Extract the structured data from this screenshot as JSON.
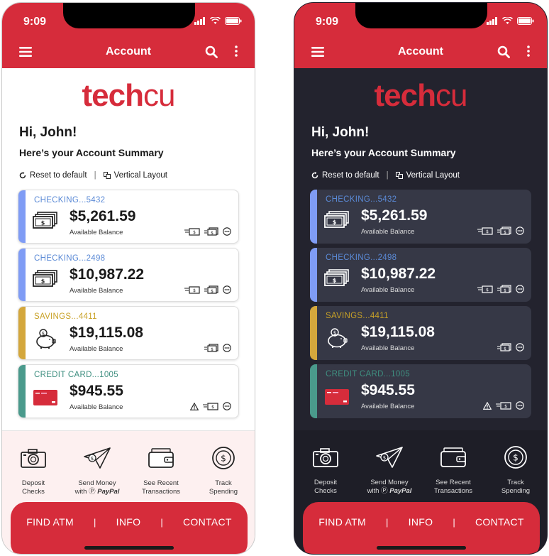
{
  "status_bar": {
    "time": "9:09"
  },
  "header": {
    "title": "Account"
  },
  "brand": {
    "logo_tech": "tech",
    "logo_cu": "cu"
  },
  "greeting": {
    "hello": "Hi, John!",
    "summary": "Here’s your Account Summary"
  },
  "layout_options": {
    "reset": "Reset to default",
    "separator": "|",
    "vertical": "Vertical Layout"
  },
  "accounts": [
    {
      "name": "CHECKING...5432",
      "amount": "$5,261.59",
      "label": "Available Balance",
      "stripe_color": "#7f9cf5",
      "name_color": "#5b8ad6",
      "type": "cash"
    },
    {
      "name": "CHECKING...2498",
      "amount": "$10,987.22",
      "label": "Available Balance",
      "stripe_color": "#7f9cf5",
      "name_color": "#5b8ad6",
      "type": "cash"
    },
    {
      "name": "SAVINGS...4411",
      "amount": "$19,115.08",
      "label": "Available Balance",
      "stripe_color": "#d4a73c",
      "name_color": "#c9a227",
      "type": "piggy"
    },
    {
      "name": "CREDIT CARD...1005",
      "amount": "$945.55",
      "label": "Available Balance",
      "stripe_color": "#4a9a8c",
      "name_color": "#3f8f80",
      "type": "card"
    }
  ],
  "quick_actions": [
    {
      "line1": "Deposit",
      "line2": "Checks",
      "icon": "camera-icon"
    },
    {
      "line1": "Send Money",
      "line2": "with",
      "line2_brand": "PayPal",
      "icon": "paper-plane-icon"
    },
    {
      "line1": "See Recent",
      "line2": "Transactions",
      "icon": "wallet-icon"
    },
    {
      "line1": "Track",
      "line2": "Spending",
      "icon": "coin-icon"
    }
  ],
  "bottom_nav": {
    "find_atm": "FIND ATM",
    "info": "INFO",
    "contact": "CONTACT",
    "separator": "|"
  },
  "colors": {
    "brand_red": "#d62c3b",
    "dark_bg": "#23232e",
    "dark_card": "#363846"
  }
}
